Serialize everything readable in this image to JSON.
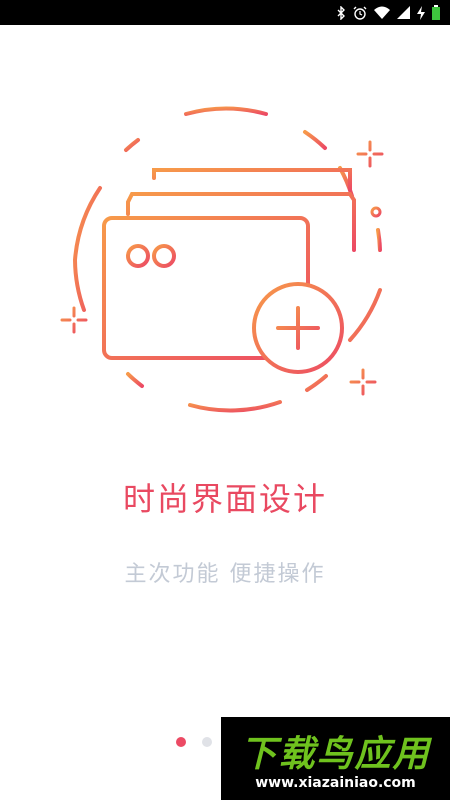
{
  "status_bar": {
    "icons": [
      "bluetooth-icon",
      "alarm-icon",
      "wifi-icon",
      "cell-signal-icon",
      "charging-icon",
      "battery-icon"
    ]
  },
  "illustration": {
    "icon": "credit-cards-add-icon"
  },
  "title": "时尚界面设计",
  "subtitle": "主次功能 便捷操作",
  "pager": {
    "count": 3,
    "active_index": 0
  },
  "watermark": {
    "title": "下载鸟应用",
    "url": "www.xiazainiao.com"
  },
  "colors": {
    "gradient_start": "#f79a4a",
    "gradient_end": "#ec4a64",
    "title": "#e94961",
    "subtitle": "#c3cad5",
    "dot_active": "#ec4a64",
    "dot_inactive": "#e0e2e7",
    "watermark_green": "#6fc21e"
  }
}
